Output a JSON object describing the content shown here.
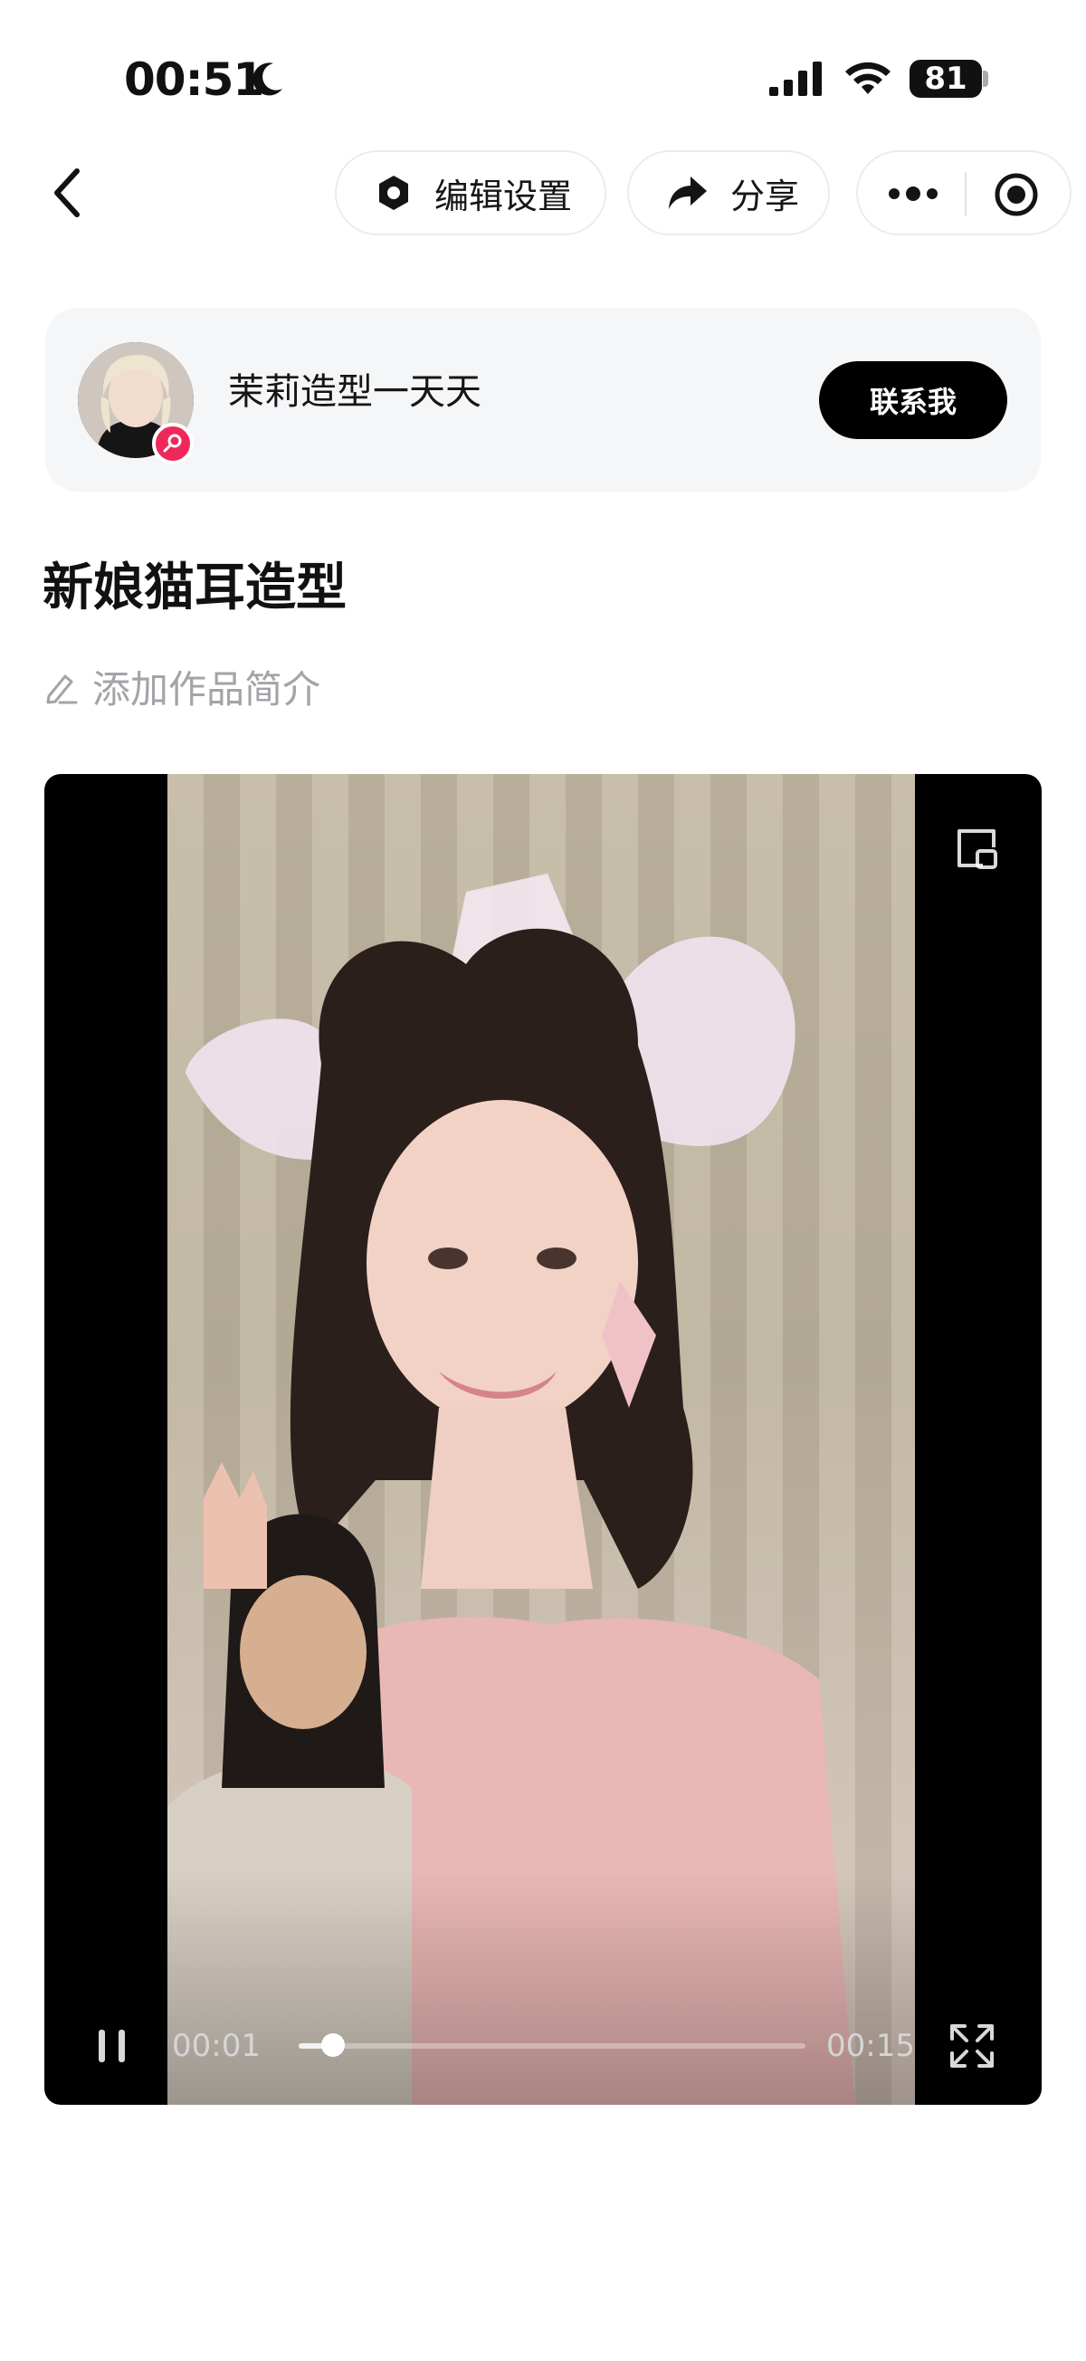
{
  "status_bar": {
    "time": "00:51",
    "battery": "81"
  },
  "header": {
    "edit_label": "编辑设置",
    "share_label": "分享"
  },
  "author": {
    "name": "茉莉造型一天天",
    "contact_label": "联系我"
  },
  "work": {
    "title": "新娘猫耳造型",
    "add_desc_label": "添加作品简介"
  },
  "player": {
    "current_time": "00:01",
    "total_time": "00:15",
    "progress": 0.067
  },
  "colors": {
    "accent_badge": "#f0285a",
    "card_bg": "#f5f6f8",
    "contact_bg": "#000000"
  },
  "icons": [
    "moon-icon",
    "signal-icon",
    "wifi-icon",
    "back-icon",
    "gear-icon",
    "share-icon",
    "more-icon",
    "record-icon",
    "edit-pencil-icon",
    "pip-icon",
    "pause-icon",
    "fullscreen-icon"
  ]
}
